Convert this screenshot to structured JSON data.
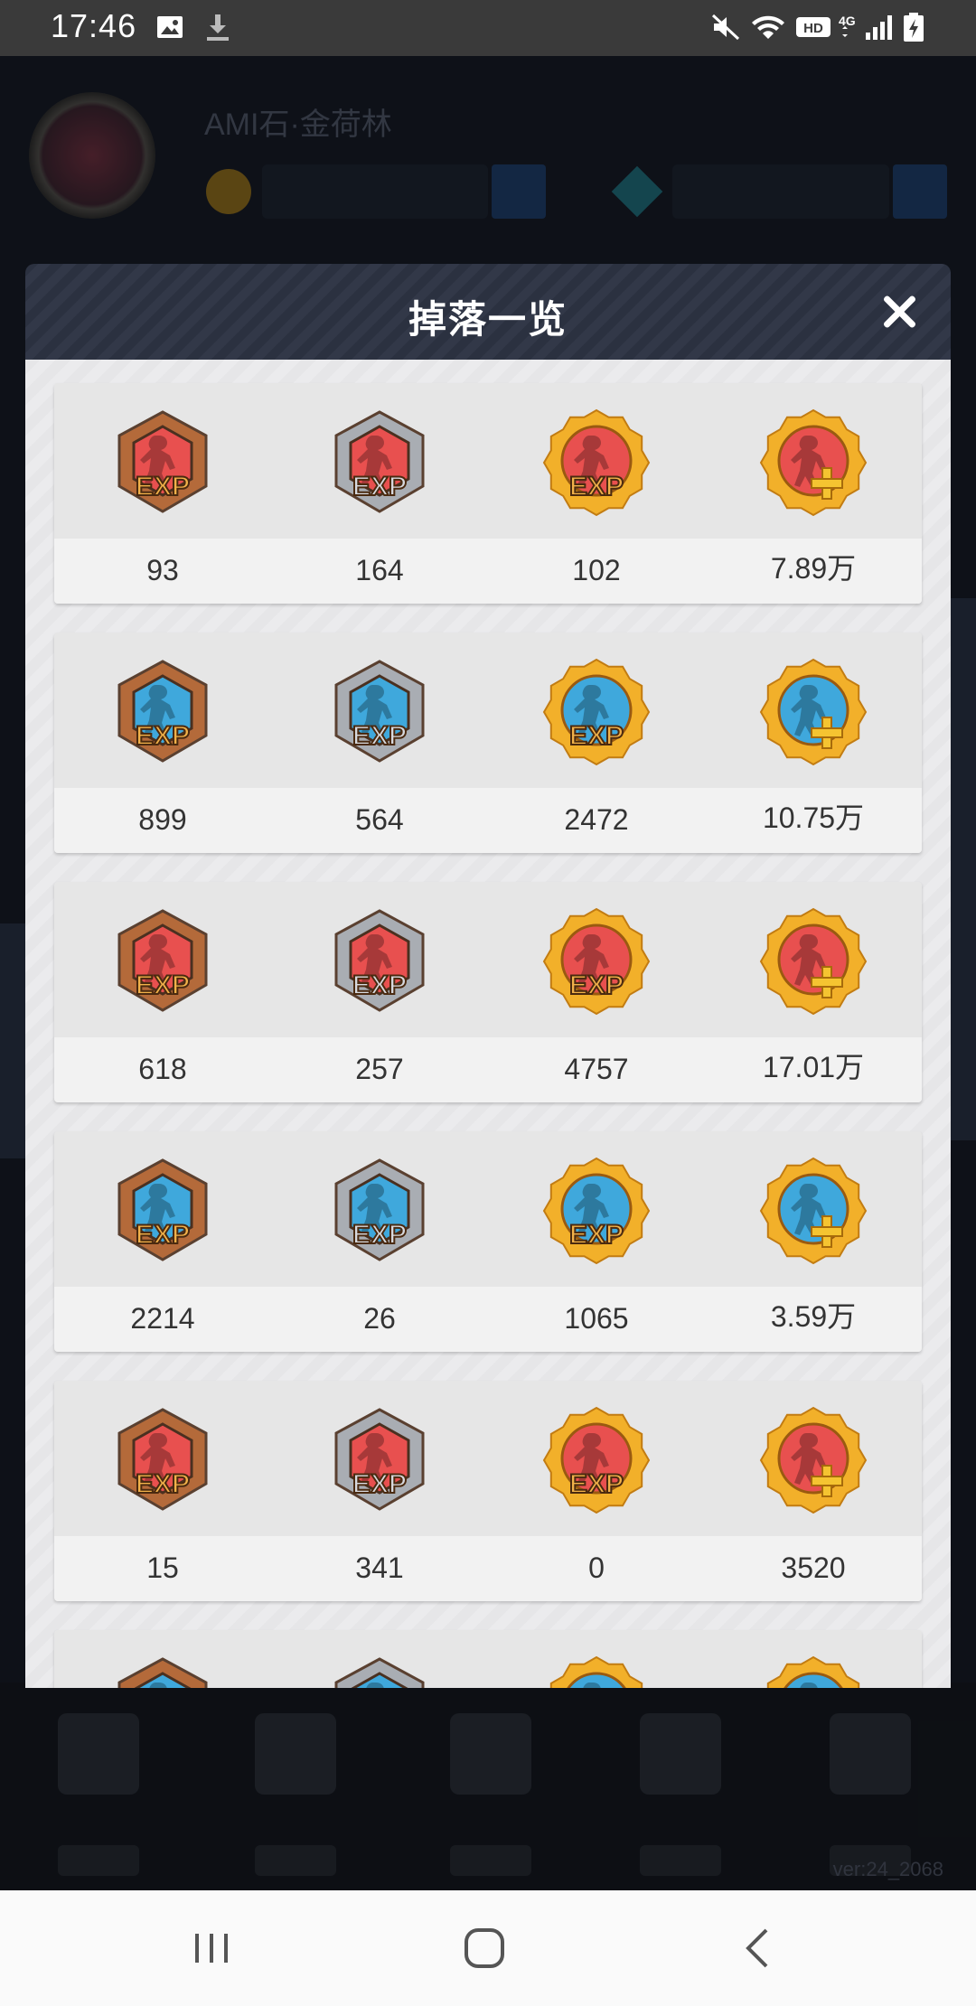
{
  "status_bar": {
    "time": "17:46",
    "icons": [
      "image-icon",
      "download-icon",
      "mute-icon",
      "wifi-icon",
      "hd-icon",
      "signal-4g-icon",
      "battery-charging-icon"
    ]
  },
  "background": {
    "player_name": "AMI石·金荷林",
    "version": "ver:24_2068"
  },
  "modal": {
    "title": "掉落一览",
    "close_icon": "close-icon"
  },
  "rows": [
    {
      "color": "red",
      "values": [
        "93",
        "164",
        "102",
        "7.89万"
      ]
    },
    {
      "color": "blue",
      "values": [
        "899",
        "564",
        "2472",
        "10.75万"
      ]
    },
    {
      "color": "red",
      "values": [
        "618",
        "257",
        "4757",
        "17.01万"
      ]
    },
    {
      "color": "blue",
      "values": [
        "2214",
        "26",
        "1065",
        "3.59万"
      ]
    },
    {
      "color": "red",
      "values": [
        "15",
        "341",
        "0",
        "3520"
      ]
    },
    {
      "color": "blue",
      "values": []
    }
  ],
  "badge_tiers": [
    "bronze-exp-badge",
    "silver-exp-badge",
    "gold-exp-badge",
    "gold-plus-badge"
  ],
  "colors": {
    "red_fill": "#e8504f",
    "blue_fill": "#3fa8dc",
    "bronze": "#b46a3a",
    "silver": "#a9adb3",
    "gold": "#f2b02a"
  },
  "system_nav": [
    "recents-icon",
    "home-icon",
    "back-icon"
  ]
}
